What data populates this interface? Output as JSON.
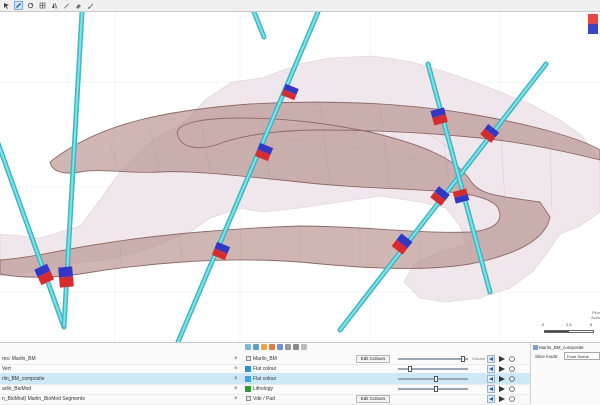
{
  "colors": {
    "drillhole": "#5ed1d8",
    "vein_fill": "#b4918f",
    "envelope": "#efe6ec",
    "interval_red": "#d92b2b",
    "interval_blue": "#2f38c8",
    "selected_row": "#cde8f6"
  },
  "toolbar": {
    "icons": [
      "select-icon",
      "pencil-icon",
      "rotate-icon",
      "grid-icon",
      "flip-icon",
      "pen-icon",
      "eraser-icon",
      "brush-icon"
    ]
  },
  "scale": {
    "ticks": [
      "0",
      "2.5",
      "5"
    ],
    "unit_lines": [
      "Plun",
      "Azim"
    ]
  },
  "panel": {
    "rows": [
      {
        "name": "res: Marlin_BM",
        "label": "Marlin_BM",
        "button": "Edit Colours",
        "has_slider": true,
        "slider_value": 0.95,
        "num": "Volume"
      },
      {
        "name": "Vert",
        "label": "Flat colour",
        "button": "",
        "has_slider": true,
        "slider_value": 0.15,
        "num": ""
      },
      {
        "name": "rlin_BM_composite",
        "label": "Flat colour",
        "button": "",
        "has_slider": true,
        "slider_value": 0.55,
        "num": ""
      },
      {
        "name": "arlin_BioMod",
        "label": "Lithology",
        "button": "",
        "has_slider": true,
        "slider_value": 0.55,
        "num": ""
      },
      {
        "name": "n_BioMod) Marlin_BioMod Segments",
        "label": "Vdir / Pad",
        "button": "Edit Colours",
        "has_slider": false,
        "slider_value": 0,
        "num": ""
      }
    ]
  },
  "side": {
    "title": "Marlin_BM_composite",
    "slice_label": "Slice mode:",
    "slice_value": "From Scene"
  }
}
